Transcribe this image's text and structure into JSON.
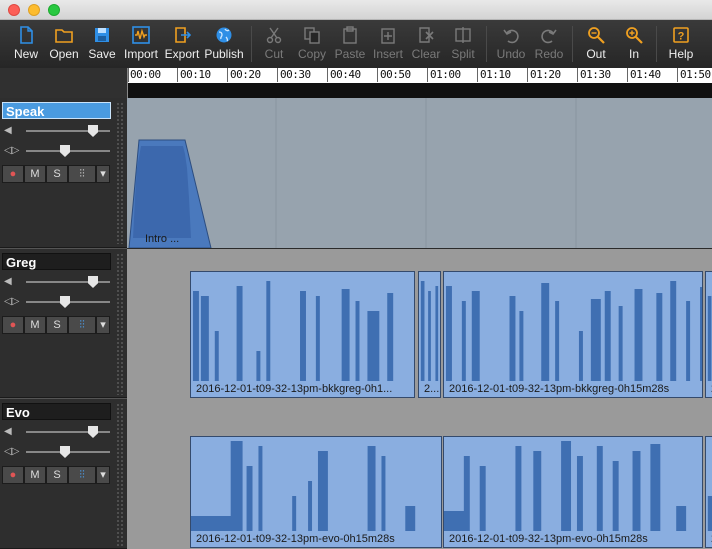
{
  "window": {
    "controls": [
      "close",
      "minimize",
      "zoom"
    ]
  },
  "toolbar": {
    "new": "New",
    "open": "Open",
    "save": "Save",
    "import": "Import",
    "export": "Export",
    "publish": "Publish",
    "cut": "Cut",
    "copy": "Copy",
    "paste": "Paste",
    "insert": "Insert",
    "clear": "Clear",
    "split": "Split",
    "undo": "Undo",
    "redo": "Redo",
    "zoom_out": "Out",
    "zoom_in": "In",
    "help": "Help"
  },
  "ruler": {
    "ticks": [
      "00:00",
      "00:10",
      "00:20",
      "00:30",
      "00:40",
      "00:50",
      "01:00",
      "01:10",
      "01:20",
      "01:30",
      "01:40",
      "01:50"
    ]
  },
  "tracks": [
    {
      "name": "Speak",
      "selected": true,
      "volume": 0.82,
      "pan": 0.5,
      "buttons": {
        "record": "●",
        "mute": "M",
        "solo": "S",
        "fx": "⫶⫶",
        "menu": "▾"
      },
      "clips": [
        {
          "label": "Intro ..."
        }
      ]
    },
    {
      "name": "Greg",
      "selected": false,
      "volume": 0.82,
      "pan": 0.5,
      "buttons": {
        "record": "●",
        "mute": "M",
        "solo": "S",
        "fx": "⫶⫶",
        "menu": "▾"
      },
      "clips": [
        {
          "label": "2016-12-01-t09-32-13pm-bkkgreg-0h1..."
        },
        {
          "label": "2..."
        },
        {
          "label": "2016-12-01-t09-32-13pm-bkkgreg-0h15m28s"
        },
        {
          "label": "2"
        }
      ]
    },
    {
      "name": "Evo",
      "selected": false,
      "volume": 0.82,
      "pan": 0.5,
      "buttons": {
        "record": "●",
        "mute": "M",
        "solo": "S",
        "fx": "⫶⫶",
        "menu": "▾"
      },
      "clips": [
        {
          "label": "2016-12-01-t09-32-13pm-evo-0h15m28s"
        },
        {
          "label": "2016-12-01-t09-32-13pm-evo-0h15m28s"
        },
        {
          "label": "2"
        }
      ]
    }
  ],
  "colors": {
    "accent": "#2f8fe6",
    "toolbar_icon_orange": "#f0a020",
    "clip_fill": "#8aaee0",
    "wave": "#3f6fb2"
  }
}
